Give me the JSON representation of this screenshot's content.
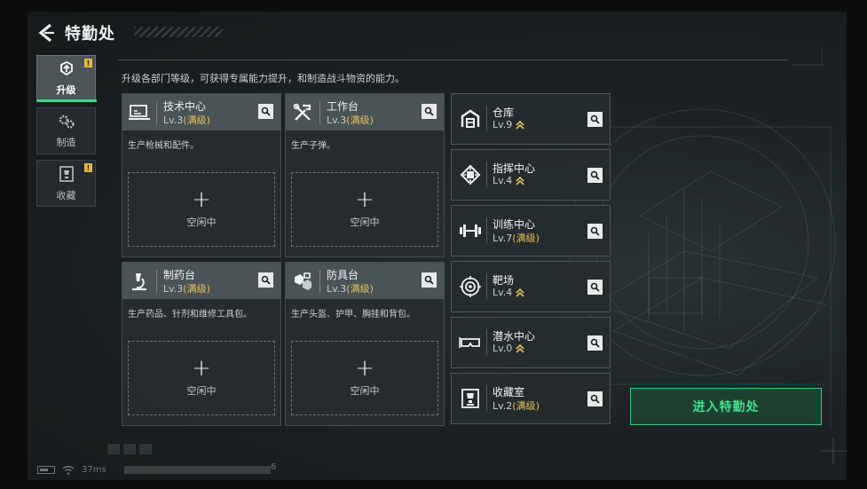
{
  "header": {
    "title": "特勤处",
    "back_icon": "back-arrow-icon"
  },
  "description": "升级各部门等级，可获得专属能力提升，和制造战斗物资的能力。",
  "nav": [
    {
      "label": "升级",
      "icon": "upgrade-icon",
      "active": true,
      "badge": "!"
    },
    {
      "label": "制造",
      "icon": "gears-icon",
      "active": false,
      "badge": ""
    },
    {
      "label": "收藏",
      "icon": "collection-icon",
      "active": false,
      "badge": "!"
    }
  ],
  "big_cards": [
    {
      "name": "技术中心",
      "level": "Lv.3",
      "status": "(满级)",
      "desc": "生产枪械和配件。",
      "slot_label": "空闲中",
      "icon": "monitor-icon"
    },
    {
      "name": "工作台",
      "level": "Lv.3",
      "status": "(满级)",
      "desc": "生产子弹。",
      "slot_label": "空闲中",
      "icon": "tools-icon"
    },
    {
      "name": "制药台",
      "level": "Lv.3",
      "status": "(满级)",
      "desc": "生产药品、针剂和维修工具包。",
      "slot_label": "空闲中",
      "icon": "microscope-icon"
    },
    {
      "name": "防具台",
      "level": "Lv.3",
      "status": "(满级)",
      "desc": "生产头盔、护甲、胸挂和背包。",
      "slot_label": "空闲中",
      "icon": "armor-icon"
    }
  ],
  "small_cards": [
    {
      "name": "仓库",
      "level": "Lv.9",
      "status": "",
      "upgradable": true,
      "icon": "warehouse-icon"
    },
    {
      "name": "指挥中心",
      "level": "Lv.4",
      "status": "",
      "upgradable": true,
      "icon": "chip-icon"
    },
    {
      "name": "训练中心",
      "level": "Lv.7",
      "status": "(满级)",
      "upgradable": false,
      "icon": "dumbbell-icon"
    },
    {
      "name": "靶场",
      "level": "Lv.4",
      "status": "",
      "upgradable": true,
      "icon": "target-icon"
    },
    {
      "name": "潜水中心",
      "level": "Lv.0",
      "status": "",
      "upgradable": true,
      "icon": "diving-mask-icon"
    },
    {
      "name": "收藏室",
      "level": "Lv.2",
      "status": "(满级)",
      "upgradable": false,
      "icon": "trophy-icon"
    }
  ],
  "enter_button": "进入特勤处",
  "status_bar": {
    "ping": "37ms",
    "uid_tail": "6"
  },
  "colors": {
    "accent_green": "#3fe08f",
    "maxed_gold": "#e3c15a",
    "badge_yellow": "#e6b544"
  }
}
